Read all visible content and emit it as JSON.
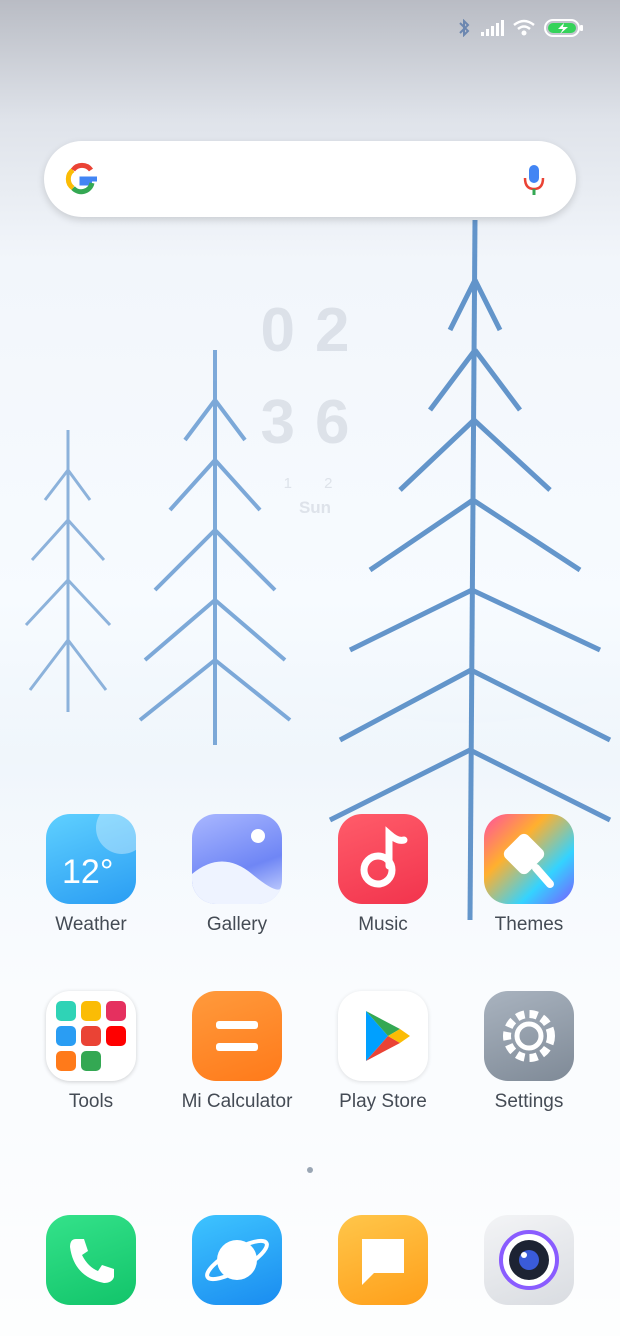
{
  "status_bar": {
    "icons": [
      "bluetooth-icon",
      "signal-icon",
      "wifi-icon",
      "battery-charging-icon"
    ]
  },
  "search": {
    "logo": "google-g-logo",
    "mic_icon": "microphone-icon"
  },
  "clock": {
    "hour": "02",
    "minute": "36",
    "date": "1 2",
    "day": "Sun"
  },
  "apps": [
    {
      "label": "Weather",
      "icon": "weather-icon",
      "temp": "12°"
    },
    {
      "label": "Gallery",
      "icon": "gallery-icon"
    },
    {
      "label": "Music",
      "icon": "music-note-icon"
    },
    {
      "label": "Themes",
      "icon": "paintbrush-icon"
    },
    {
      "label": "Tools",
      "icon": "folder-icon"
    },
    {
      "label": "Mi Calculator",
      "icon": "calculator-icon"
    },
    {
      "label": "Play Store",
      "icon": "play-store-icon"
    },
    {
      "label": "Settings",
      "icon": "gear-icon"
    }
  ],
  "dock": [
    {
      "icon": "phone-icon"
    },
    {
      "icon": "browser-icon"
    },
    {
      "icon": "messages-icon"
    },
    {
      "icon": "camera-icon"
    }
  ],
  "colors": {
    "weather": "#2a9df3",
    "music": "#f2344d",
    "calculator": "#ff7a1a",
    "settings": "#7f8a97",
    "phone": "#12c46a",
    "browser": "#1a8cf0",
    "messages": "#ff9f1a",
    "battery": "#35d35a"
  }
}
